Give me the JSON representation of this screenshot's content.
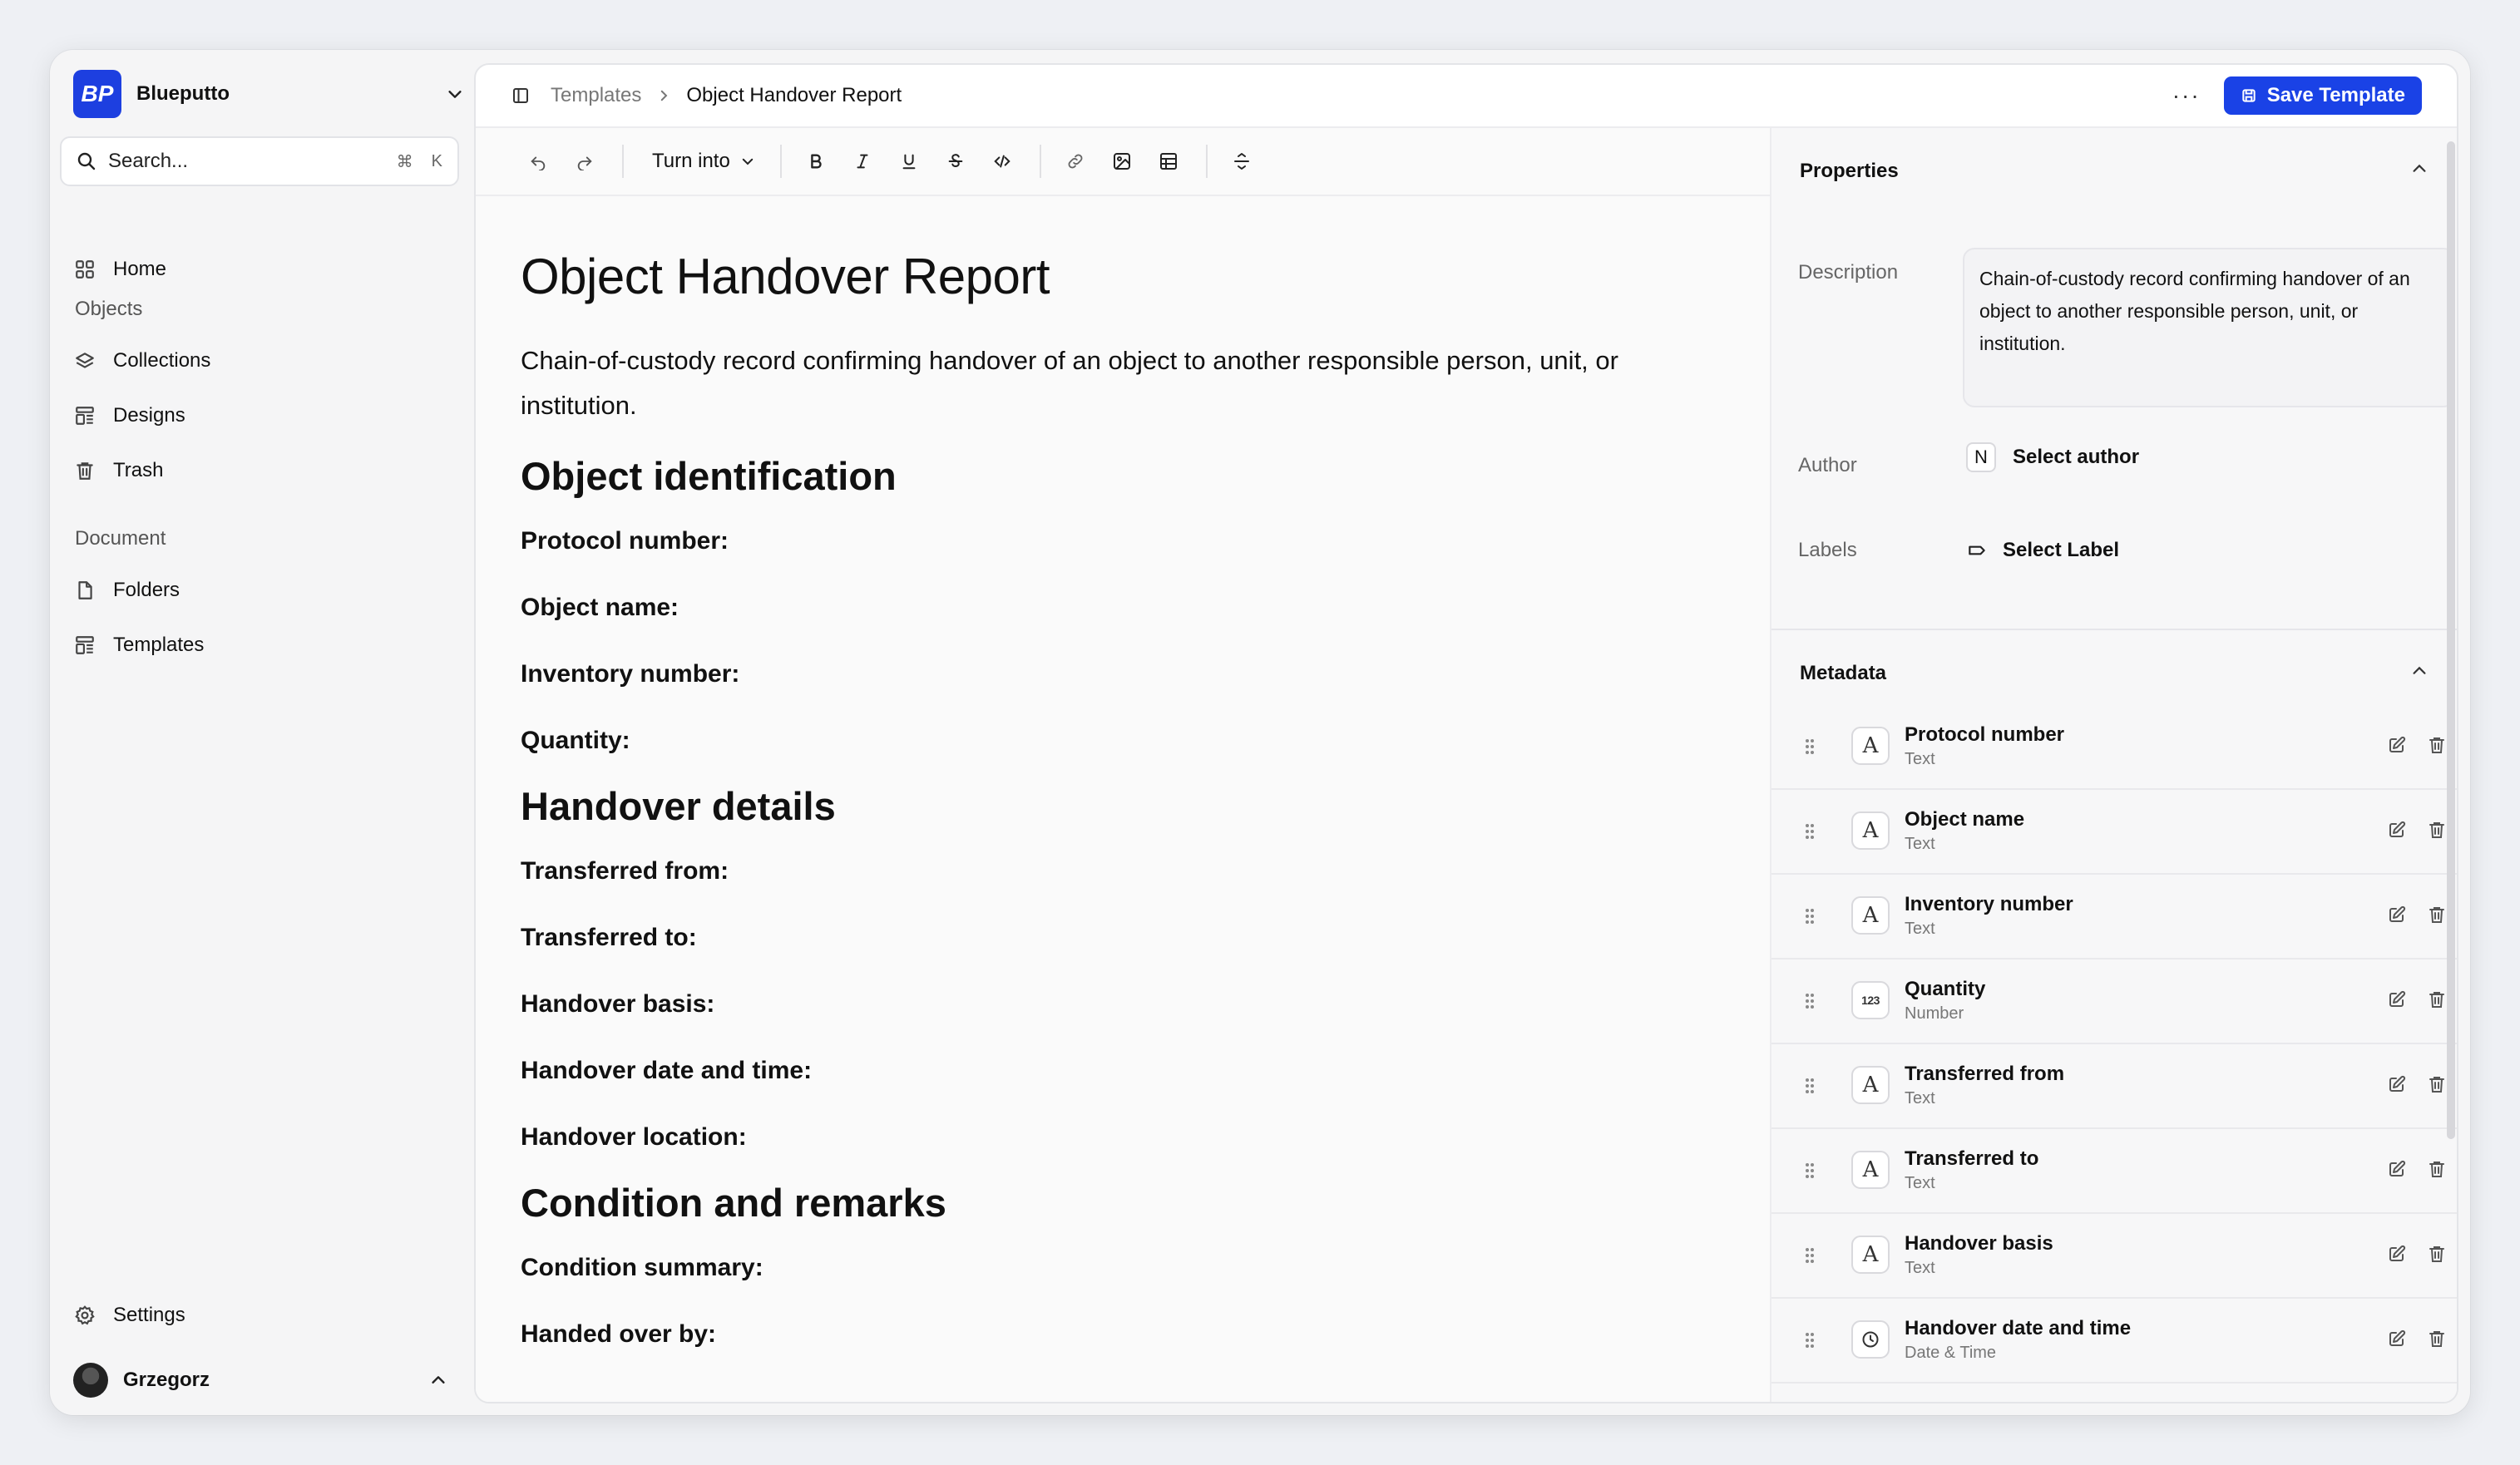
{
  "workspace": {
    "name": "Blueputto",
    "logo_text": "BP"
  },
  "search": {
    "label": "Search...",
    "shortcut_cmd": "⌘",
    "shortcut_key": "K"
  },
  "sidebar": {
    "home": "Home",
    "objects_section": "Objects",
    "collections": "Collections",
    "designs": "Designs",
    "trash": "Trash",
    "document_section": "Document",
    "folders": "Folders",
    "templates": "Templates",
    "settings": "Settings",
    "user": "Grzegorz"
  },
  "breadcrumb": {
    "parent": "Templates",
    "current": "Object Handover Report"
  },
  "topbar": {
    "more": "···",
    "save_label": "Save Template"
  },
  "toolbar": {
    "turn_into": "Turn into"
  },
  "doc": {
    "title": "Object Handover Report",
    "description": "Chain-of-custody record confirming handover of an object to another responsible person, unit, or institution.",
    "sections": [
      {
        "heading": "Object identification",
        "fields": [
          "Protocol number:",
          "Object name:",
          "Inventory number:",
          "Quantity:"
        ]
      },
      {
        "heading": "Handover details",
        "fields": [
          "Transferred from:",
          "Transferred to:",
          "Handover basis:",
          "Handover date and time:",
          "Handover location:"
        ]
      },
      {
        "heading": "Condition and remarks",
        "fields": [
          "Condition summary:",
          "Handed over by:"
        ]
      }
    ]
  },
  "properties": {
    "title": "Properties",
    "description_label": "Description",
    "description_value": "Chain-of-custody record confirming handover of an object to another responsible person, unit, or institution.",
    "author_label": "Author",
    "author_badge": "N",
    "author_value": "Select author",
    "labels_label": "Labels",
    "labels_value": "Select Label"
  },
  "metadata": {
    "title": "Metadata",
    "items": [
      {
        "name": "Protocol number",
        "type": "Text",
        "icon": "text-type-icon"
      },
      {
        "name": "Object name",
        "type": "Text",
        "icon": "text-type-icon"
      },
      {
        "name": "Inventory number",
        "type": "Text",
        "icon": "text-type-icon"
      },
      {
        "name": "Quantity",
        "type": "Number",
        "icon": "number-type-icon"
      },
      {
        "name": "Transferred from",
        "type": "Text",
        "icon": "text-type-icon"
      },
      {
        "name": "Transferred to",
        "type": "Text",
        "icon": "text-type-icon"
      },
      {
        "name": "Handover basis",
        "type": "Text",
        "icon": "text-type-icon"
      },
      {
        "name": "Handover date and time",
        "type": "Date & Time",
        "icon": "clock-icon"
      }
    ]
  },
  "colors": {
    "accent": "#1a42e6",
    "logo_bg": "#1d3fe0"
  }
}
